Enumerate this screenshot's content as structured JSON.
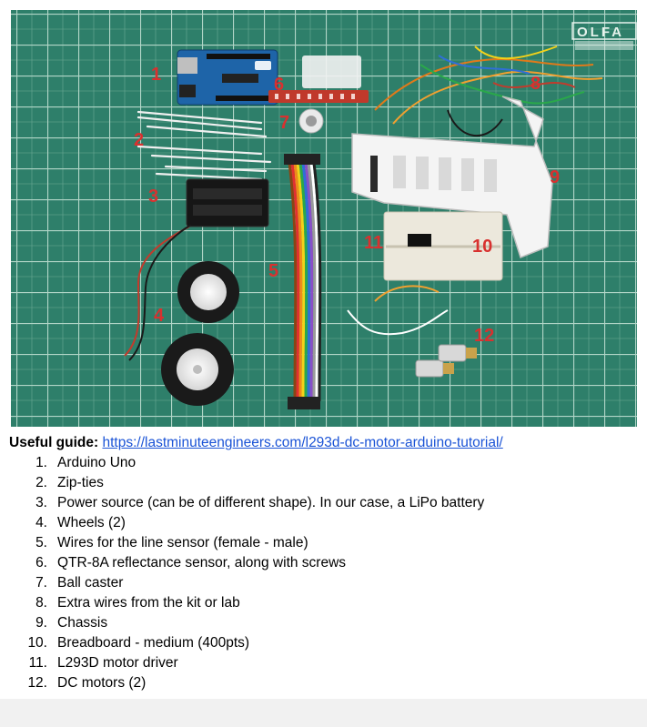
{
  "photo": {
    "description_alt": "Robot car kit parts laid out on a green cutting mat",
    "mat_brand": "OLFA",
    "colors": {
      "mat": "#2e7f6a",
      "grid": "#c9e6d8",
      "label": "#d8312f"
    },
    "labels": [
      "1",
      "2",
      "3",
      "4",
      "5",
      "6",
      "7",
      "8",
      "9",
      "10",
      "11",
      "12"
    ]
  },
  "guide": {
    "prefix": "Useful guide:",
    "url_text": "https://lastminuteengineers.com/l293d-dc-motor-arduino-tutorial/",
    "link_color": "#1a53d6"
  },
  "parts": [
    {
      "num": "1.",
      "text": "Arduino Uno"
    },
    {
      "num": "2.",
      "text": "Zip-ties"
    },
    {
      "num": "3.",
      "text": "Power source (can be of different shape). In our case, a LiPo battery"
    },
    {
      "num": "4.",
      "text": "Wheels (2)"
    },
    {
      "num": "5.",
      "text": "Wires for the line sensor (female - male)"
    },
    {
      "num": "6.",
      "text": "QTR-8A reflectance sensor, along with screws"
    },
    {
      "num": "7.",
      "text": "Ball caster"
    },
    {
      "num": "8.",
      "text": "Extra wires from the kit or lab"
    },
    {
      "num": "9.",
      "text": "Chassis"
    },
    {
      "num": "10.",
      "text": "Breadboard - medium (400pts)"
    },
    {
      "num": "11.",
      "text": "L293D motor driver"
    },
    {
      "num": "12.",
      "text": "DC motors (2)"
    }
  ]
}
